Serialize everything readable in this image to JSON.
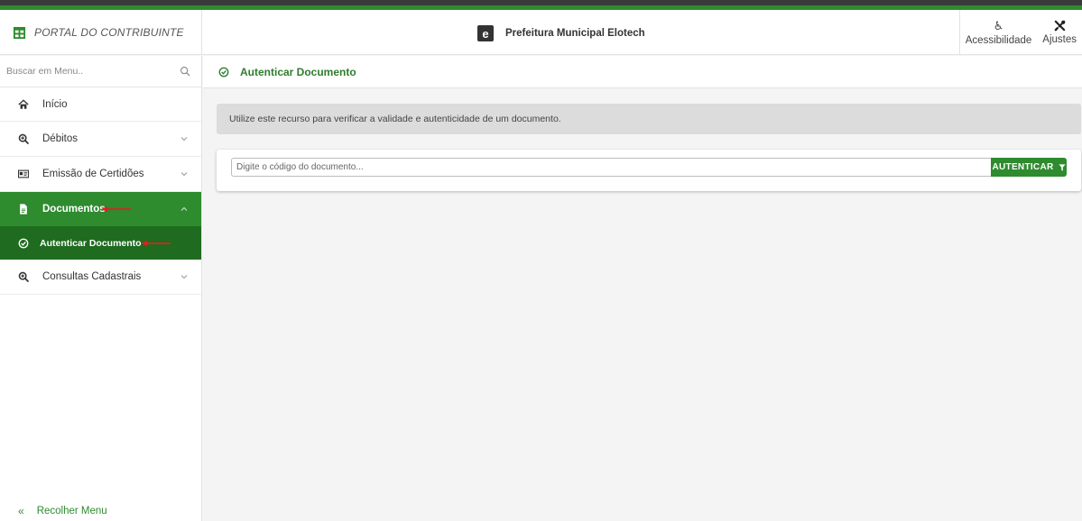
{
  "header": {
    "brand_title": "PORTAL DO CONTRIBUINTE",
    "org_logo_letter": "e",
    "org_name": "Prefeitura Municipal Elotech",
    "accessibility_label": "Acessibilidade",
    "settings_label": "Ajustes"
  },
  "sidebar": {
    "search_placeholder": "Buscar em Menu..",
    "items": [
      {
        "label": "Início",
        "icon": "home-icon"
      },
      {
        "label": "Débitos",
        "icon": "search-plus-icon"
      },
      {
        "label": "Emissão de Certidões",
        "icon": "id-card-icon"
      },
      {
        "label": "Documentos",
        "icon": "document-icon"
      },
      {
        "label": "Autenticar Documento",
        "icon": "check-circle-icon"
      },
      {
        "label": "Consultas Cadastrais",
        "icon": "search-plus-icon"
      }
    ],
    "collapse_icon": "«",
    "collapse_label": "Recolher Menu"
  },
  "content": {
    "title": "Autenticar Documento",
    "info_text": "Utilize este recurso para verificar a validade e autenticidade de um documento.",
    "code_placeholder": "Digite o código do documento...",
    "authenticate_button": "AUTENTICAR"
  },
  "colors": {
    "primary_green": "#2e8b2e",
    "submenu_green": "#1f6b1f",
    "annotation_red": "#e02020"
  }
}
